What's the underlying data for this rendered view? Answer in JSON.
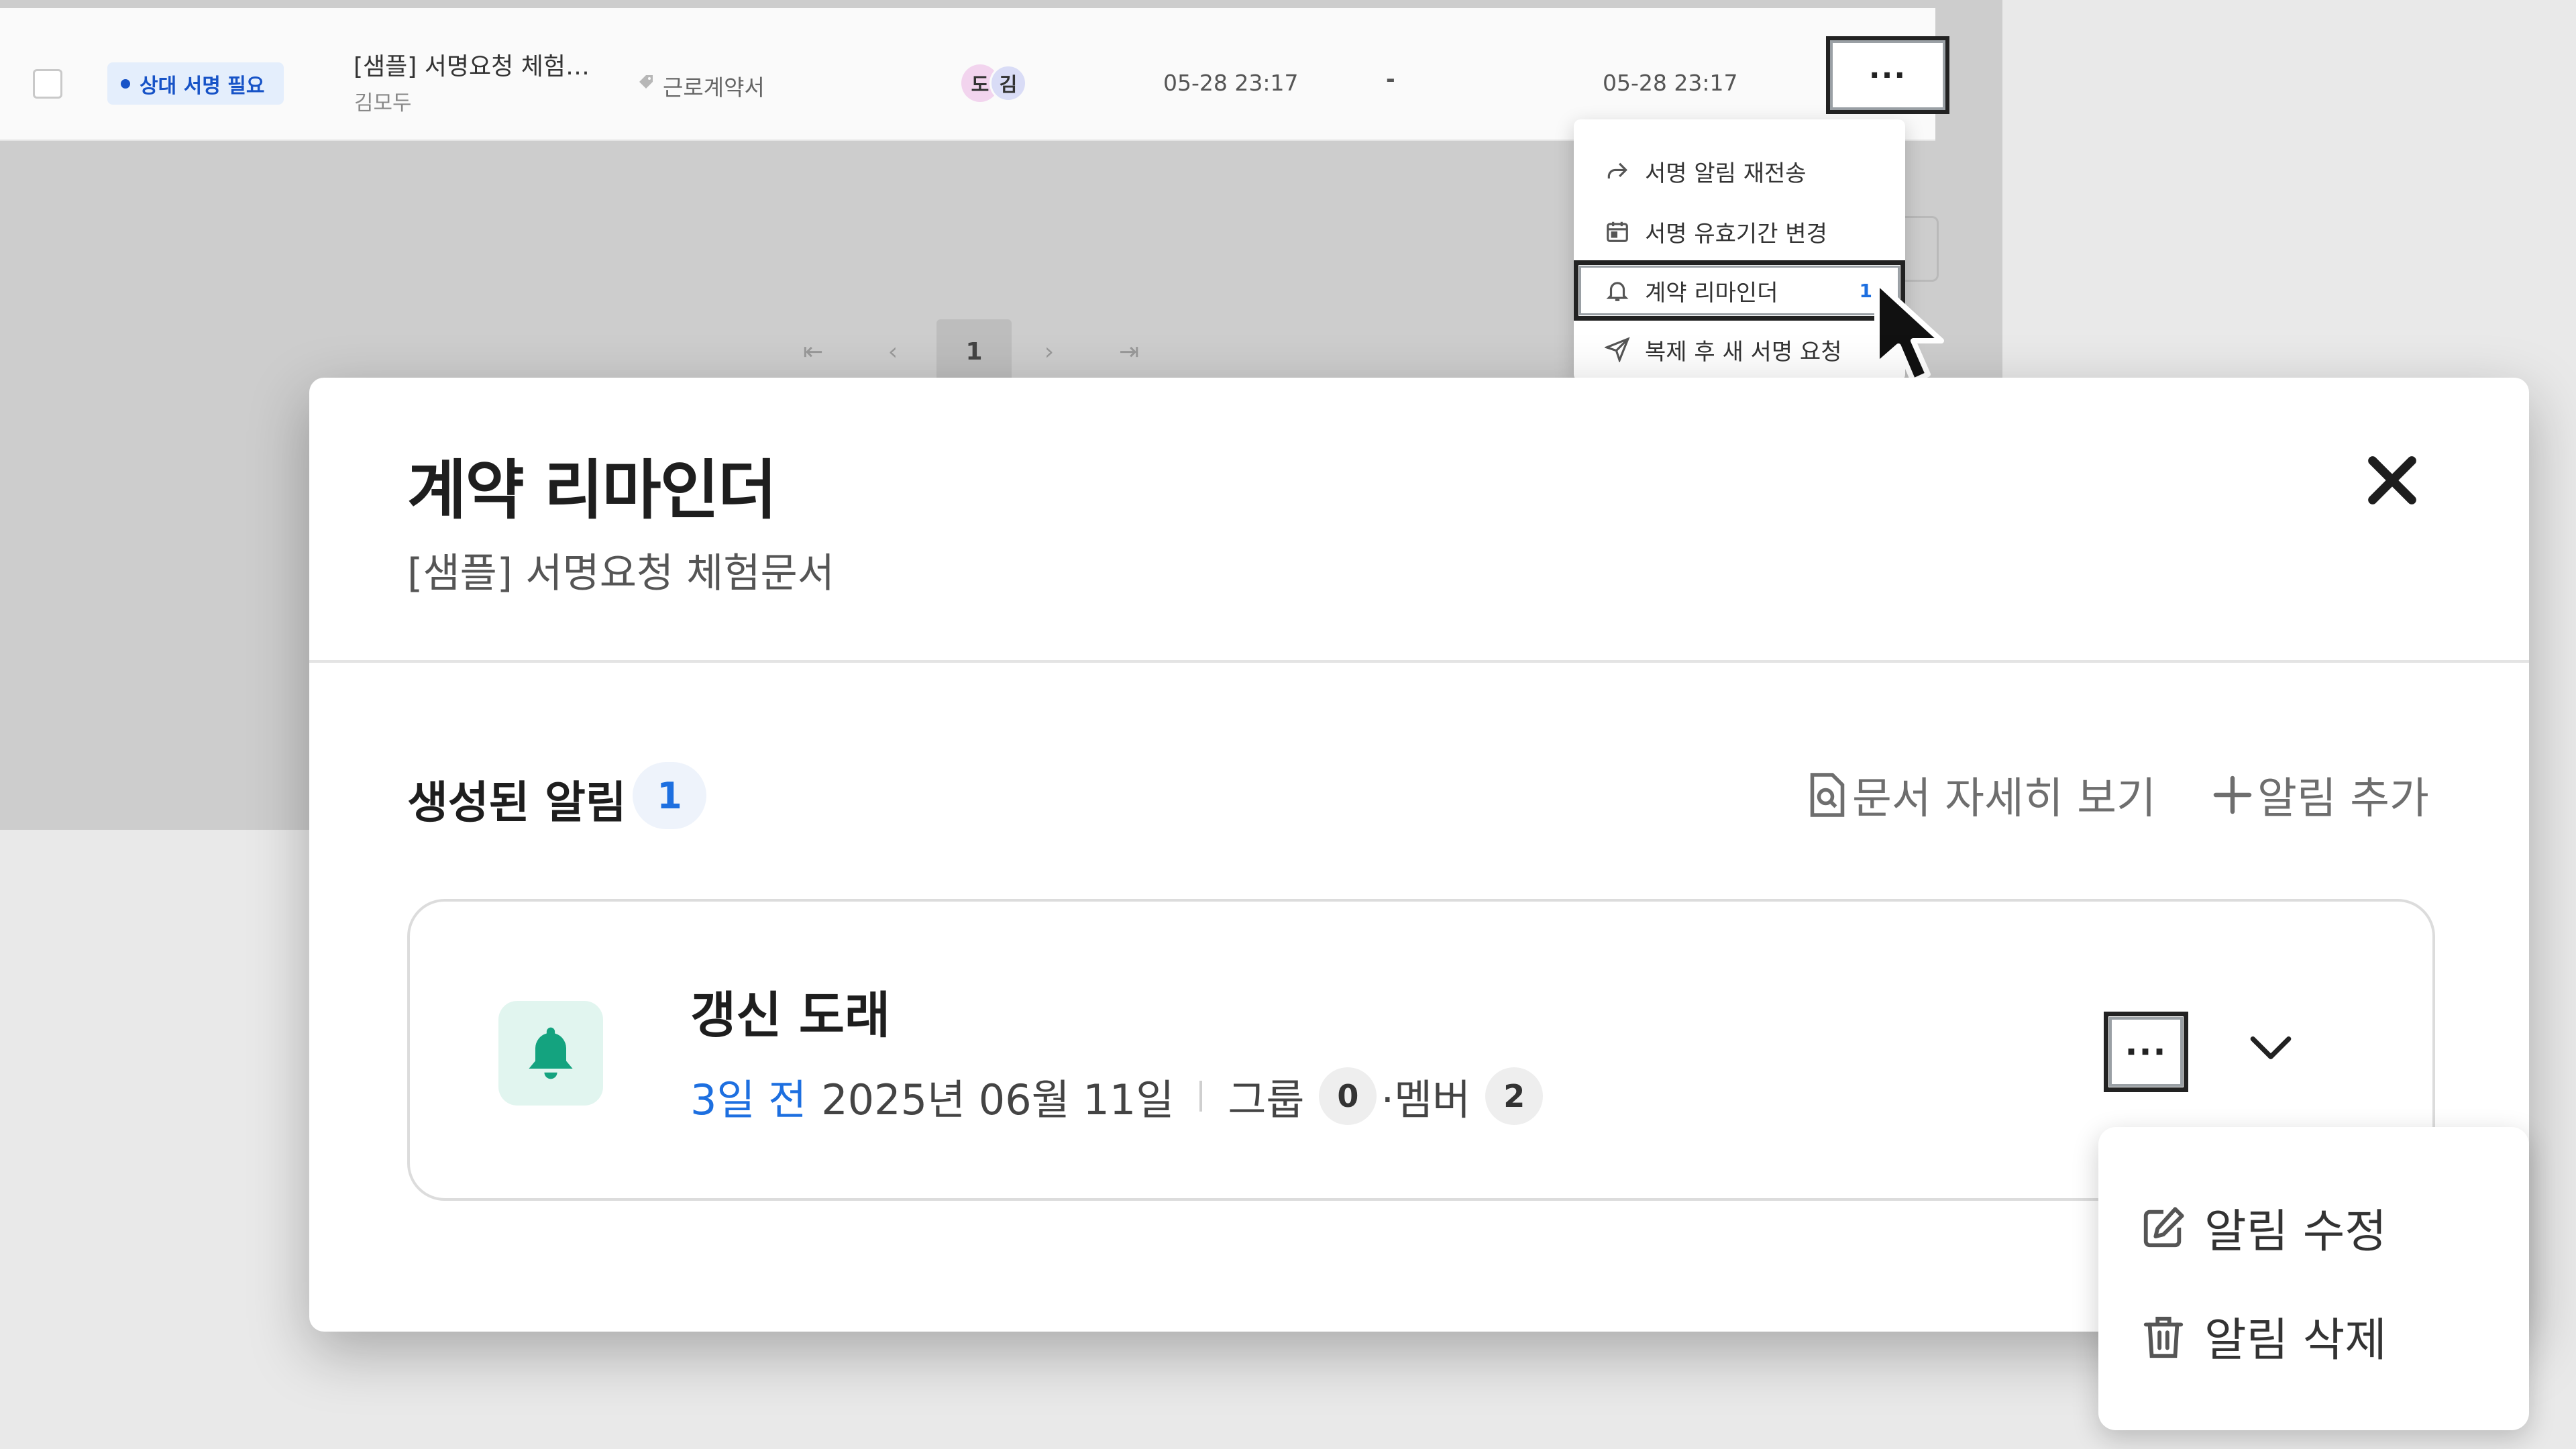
{
  "table_row": {
    "status_badge": "상대 서명 필요",
    "doc_title": "[샘플] 서명요청 체험문서",
    "sender": "김모두",
    "tag": "근로계약서",
    "avatars": [
      "도",
      "김"
    ],
    "created": "05-28 23:17",
    "signed": "-",
    "updated": "05-28 23:17",
    "more_label": "···"
  },
  "pagination": {
    "first": "⇤",
    "prev": "‹",
    "current": "1",
    "next": "›",
    "last": "⇥"
  },
  "row_menu": {
    "items": [
      {
        "label": "서명 알림 재전송",
        "icon": "share-arrow-icon"
      },
      {
        "label": "서명 유효기간 변경",
        "icon": "calendar-icon"
      },
      {
        "label": "계약 리마인더",
        "icon": "bell-icon",
        "count": "1"
      },
      {
        "label": "복제 후 새 서명 요청",
        "icon": "send-icon"
      }
    ]
  },
  "modal": {
    "title": "계약 리마인더",
    "subtitle": "[샘플] 서명요청 체험문서",
    "section_title": "생성된 알림",
    "section_count": "1",
    "actions": {
      "view_doc": "문서 자세히 보기",
      "add_alarm": "알림 추가"
    },
    "card": {
      "title": "갱신 도래",
      "relative": "3일 전",
      "date": "2025년 06월 11일",
      "group_label": "그룹",
      "group_count": "0",
      "member_label": "·멤버",
      "member_count": "2",
      "more_label": "···"
    },
    "card_menu": {
      "edit": "알림 수정",
      "delete": "알림 삭제"
    }
  },
  "colors": {
    "accent": "#1d6fe0",
    "bell": "#14a37f",
    "badge_bg": "#e4eefc"
  }
}
